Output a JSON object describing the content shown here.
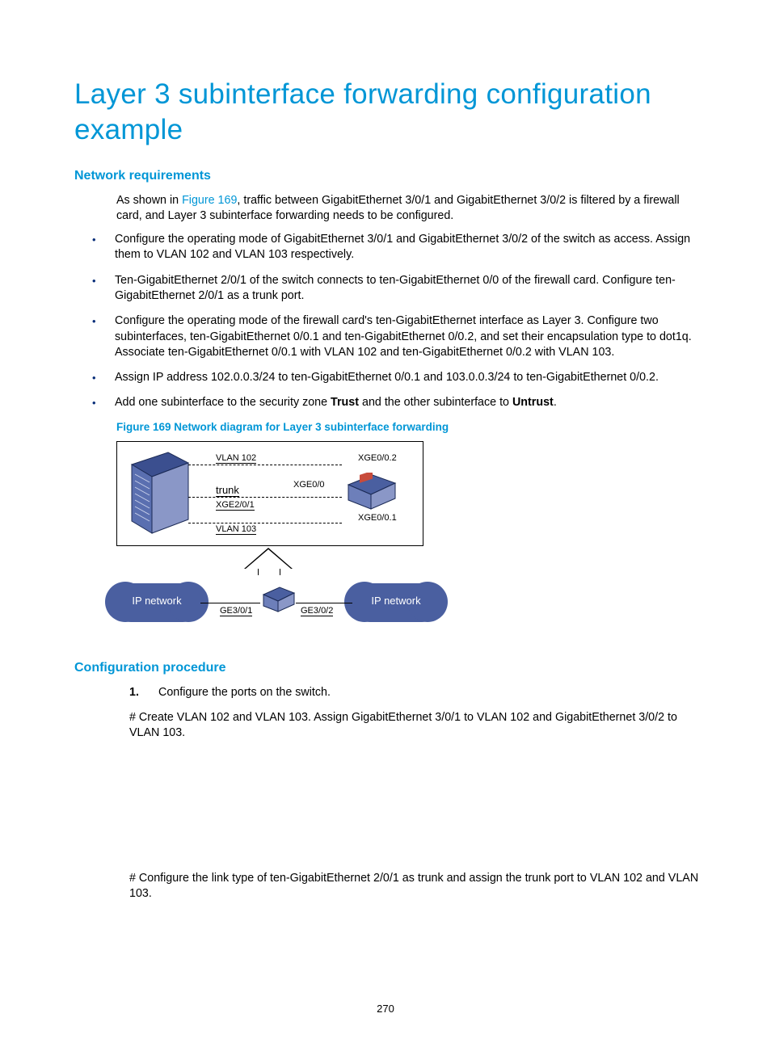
{
  "title": "Layer 3 subinterface forwarding configuration example",
  "sec1": {
    "heading": "Network requirements",
    "intro_a": "As shown in ",
    "intro_link": "Figure 169",
    "intro_b": ", traffic between GigabitEthernet 3/0/1 and GigabitEthernet 3/0/2 is filtered by a firewall card, and Layer 3 subinterface forwarding needs to be configured.",
    "bullets": [
      "Configure the operating mode of GigabitEthernet 3/0/1 and GigabitEthernet 3/0/2 of the switch as access. Assign them to VLAN 102 and VLAN 103 respectively.",
      "Ten-GigabitEthernet 2/0/1 of the switch connects to ten-GigabitEthernet 0/0 of the firewall card. Configure ten-GigabitEthernet 2/0/1 as a trunk port.",
      "Configure the operating mode of the firewall card's ten-GigabitEthernet interface as Layer 3. Configure two subinterfaces, ten-GigabitEthernet 0/0.1 and ten-GigabitEthernet 0/0.2, and set their encapsulation type to dot1q. Associate ten-GigabitEthernet 0/0.1 with VLAN 102 and ten-GigabitEthernet 0/0.2 with VLAN 103.",
      "Assign IP address 102.0.0.3/24 to ten-GigabitEthernet 0/0.1 and 103.0.0.3/24 to ten-GigabitEthernet 0/0.2."
    ],
    "bullet5_a": "Add one subinterface to the security zone ",
    "bullet5_b": "Trust",
    "bullet5_c": " and the other subinterface to ",
    "bullet5_d": "Untrust",
    "bullet5_e": "."
  },
  "figure": {
    "caption": "Figure 169 Network diagram for Layer 3 subinterface forwarding",
    "labels": {
      "vlan102": "VLAN 102",
      "vlan103": "VLAN 103",
      "trunk": "trunk",
      "xge201": "XGE2/0/1",
      "xge00": "XGE0/0",
      "xge002": "XGE0/0.2",
      "xge001": "XGE0/0.1",
      "ge301": "GE3/0/1",
      "ge302": "GE3/0/2",
      "ipnet": "IP network"
    }
  },
  "sec2": {
    "heading": "Configuration procedure",
    "step1_num": "1.",
    "step1": "Configure the ports on the switch.",
    "note1": "# Create VLAN 102 and VLAN 103. Assign GigabitEthernet 3/0/1 to VLAN 102 and GigabitEthernet 3/0/2 to VLAN 103.",
    "note2": "# Configure the link type of ten-GigabitEthernet 2/0/1 as trunk and assign the trunk port to VLAN 102 and VLAN 103."
  },
  "page_number": "270"
}
